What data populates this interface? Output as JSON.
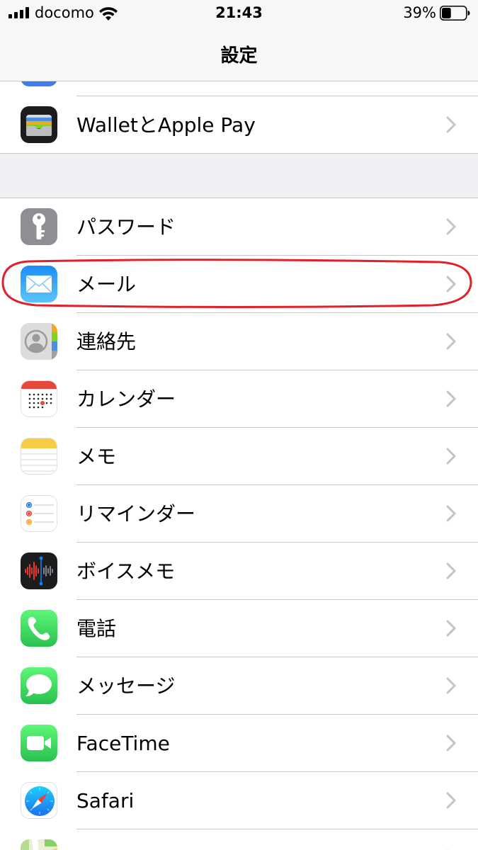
{
  "status_bar": {
    "carrier": "docomo",
    "time": "21:43",
    "battery_percent": "39%",
    "battery_level": 0.39,
    "signal_bars": 4,
    "icons": [
      "signal-icon",
      "wifi-icon",
      "battery-icon"
    ]
  },
  "nav": {
    "title": "設定"
  },
  "colors": {
    "highlight": "#e0202a",
    "separator": "#c8c7cc",
    "group_background": "#efeff4",
    "chevron": "#c4c4c7"
  },
  "group1": {
    "items": [
      {
        "label": "WalletとApple Pay",
        "icon": "wallet-icon"
      }
    ]
  },
  "group2": {
    "items": [
      {
        "label": "パスワード",
        "icon": "key-icon"
      },
      {
        "label": "メール",
        "icon": "mail-icon",
        "highlighted": true
      },
      {
        "label": "連絡先",
        "icon": "contacts-icon"
      },
      {
        "label": "カレンダー",
        "icon": "calendar-icon"
      },
      {
        "label": "メモ",
        "icon": "notes-icon"
      },
      {
        "label": "リマインダー",
        "icon": "reminders-icon"
      },
      {
        "label": "ボイスメモ",
        "icon": "voice-memos-icon"
      },
      {
        "label": "電話",
        "icon": "phone-icon"
      },
      {
        "label": "メッセージ",
        "icon": "messages-icon"
      },
      {
        "label": "FaceTime",
        "icon": "facetime-icon"
      },
      {
        "label": "Safari",
        "icon": "safari-icon"
      },
      {
        "label": "",
        "icon": "maps-icon"
      }
    ]
  }
}
